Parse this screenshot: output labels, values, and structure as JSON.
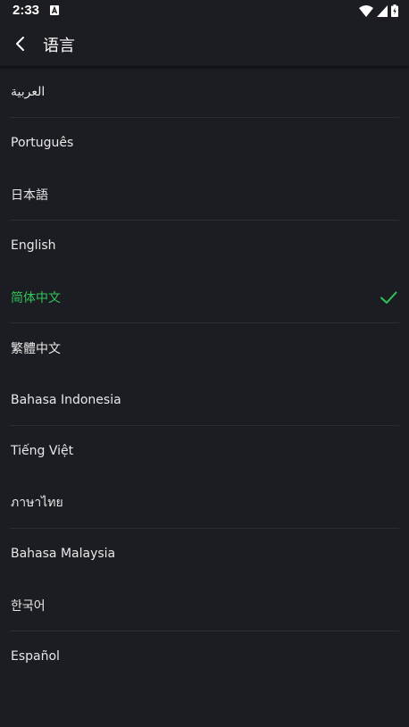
{
  "status_bar": {
    "time": "2:33"
  },
  "header": {
    "title": "语言"
  },
  "languages": [
    {
      "label": "العربية",
      "selected": false,
      "divider": true
    },
    {
      "label": "Português",
      "selected": false,
      "divider": false
    },
    {
      "label": "日本語",
      "selected": false,
      "divider": true
    },
    {
      "label": "English",
      "selected": false,
      "divider": false
    },
    {
      "label": "简体中文",
      "selected": true,
      "divider": true
    },
    {
      "label": "繁體中文",
      "selected": false,
      "divider": false
    },
    {
      "label": "Bahasa Indonesia",
      "selected": false,
      "divider": true
    },
    {
      "label": "Tiếng Việt",
      "selected": false,
      "divider": false
    },
    {
      "label": "ภาษาไทย",
      "selected": false,
      "divider": true
    },
    {
      "label": "Bahasa Malaysia",
      "selected": false,
      "divider": false
    },
    {
      "label": "한국어",
      "selected": false,
      "divider": true
    },
    {
      "label": "Español",
      "selected": false,
      "divider": false
    }
  ],
  "colors": {
    "background": "#1c1d22",
    "accent": "#2ec55a",
    "divider": "#2c2e35"
  }
}
